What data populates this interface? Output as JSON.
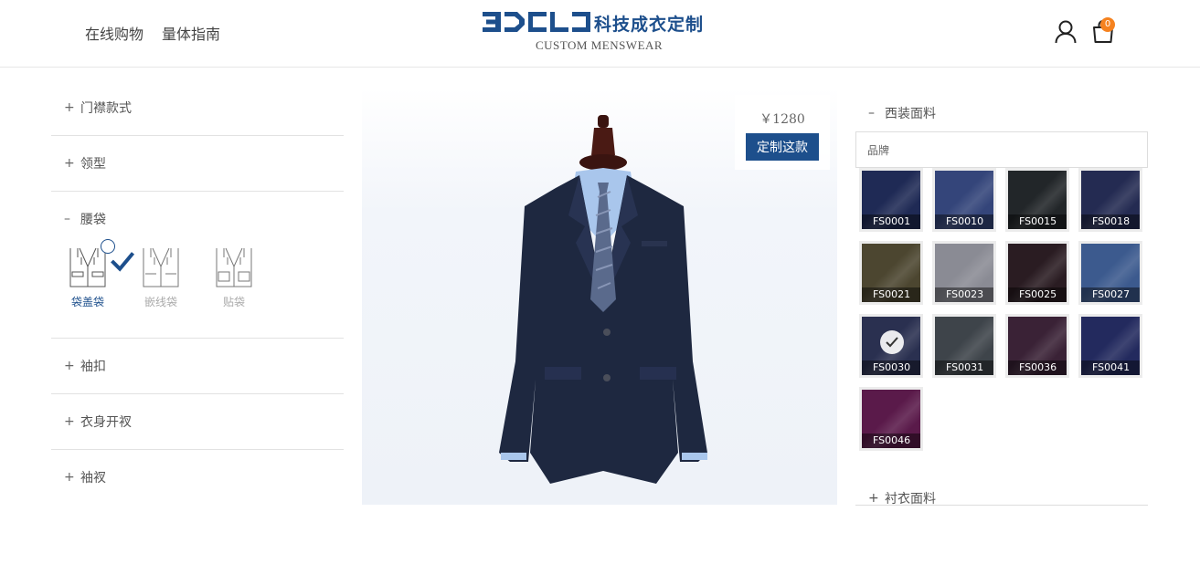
{
  "header": {
    "nav": [
      "在线购物",
      "量体指南"
    ],
    "logo_cn": "科技成衣定制",
    "logo_en": "CUSTOM MENSWEAR",
    "cart_count": "0"
  },
  "left": {
    "sections": [
      {
        "label": "门襟款式",
        "expanded": false
      },
      {
        "label": "领型",
        "expanded": false
      },
      {
        "label": "腰袋",
        "expanded": true
      },
      {
        "label": "袖扣",
        "expanded": false
      },
      {
        "label": "衣身开衩",
        "expanded": false
      },
      {
        "label": "袖衩",
        "expanded": false
      }
    ],
    "pocket_options": [
      {
        "label": "袋盖袋",
        "selected": true
      },
      {
        "label": "嵌线袋",
        "selected": false
      },
      {
        "label": "贴袋",
        "selected": false
      }
    ],
    "sign_plus": "+",
    "sign_minus": "–"
  },
  "preview": {
    "price": "￥1280",
    "cta_label": "定制这款"
  },
  "fabric": {
    "section_label": "西装面料",
    "brand_label": "品牌",
    "swatches": [
      {
        "code": "FS0001",
        "color": "#1f2a55",
        "selected": false
      },
      {
        "code": "FS0010",
        "color": "#34457a",
        "selected": false
      },
      {
        "code": "FS0015",
        "color": "#222629",
        "selected": false
      },
      {
        "code": "FS0018",
        "color": "#242b52",
        "selected": false
      },
      {
        "code": "FS0021",
        "color": "#4c4630",
        "selected": false
      },
      {
        "code": "FS0023",
        "color": "#8a8b94",
        "selected": false
      },
      {
        "code": "FS0025",
        "color": "#2a1c22",
        "selected": false
      },
      {
        "code": "FS0027",
        "color": "#3c5a8e",
        "selected": false
      },
      {
        "code": "FS0030",
        "color": "#2a3050",
        "selected": true
      },
      {
        "code": "FS0031",
        "color": "#3e444a",
        "selected": false
      },
      {
        "code": "FS0036",
        "color": "#3a2236",
        "selected": false
      },
      {
        "code": "FS0041",
        "color": "#232a5e",
        "selected": false
      },
      {
        "code": "FS0046",
        "color": "#5a1a4a",
        "selected": false
      }
    ],
    "shirt_label": "衬衣面料"
  },
  "colors": {
    "accent": "#1d4f8c",
    "badge": "#f5821f"
  }
}
